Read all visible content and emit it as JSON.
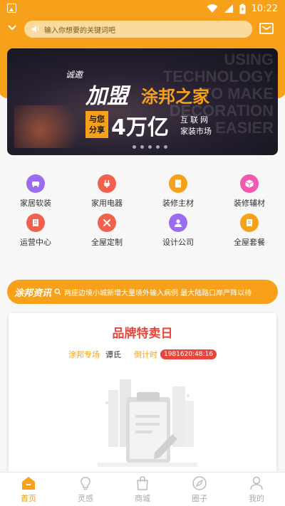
{
  "status_bar": {
    "time": "10:22"
  },
  "header": {
    "search_placeholder": "输入你想要的关键词吧"
  },
  "banner": {
    "tag_small": "诚邀",
    "tag_join": "加盟",
    "brand": "涂邦之家",
    "share_box": "与您分享",
    "amount": "4万亿",
    "right_line1": "互联网",
    "right_line2": "家装市场",
    "bg_text": "USING TECHNOLOGY TO MAKE DECORATION EASIER",
    "dot_count": 5
  },
  "categories": [
    {
      "label": "家居软装",
      "icon": "sofa-icon",
      "color": "#9b6cf0"
    },
    {
      "label": "家用电器",
      "icon": "plug-icon",
      "color": "#f2604e"
    },
    {
      "label": "装修主材",
      "icon": "door-icon",
      "color": "#f7a11a"
    },
    {
      "label": "装修辅材",
      "icon": "box-icon",
      "color": "#f05ab0"
    },
    {
      "label": "运营中心",
      "icon": "building-icon",
      "color": "#f2604e"
    },
    {
      "label": "全屋定制",
      "icon": "tools-icon",
      "color": "#f2604e"
    },
    {
      "label": "设计公司",
      "icon": "designer-icon",
      "color": "#9b6cf0"
    },
    {
      "label": "全屋套餐",
      "icon": "package-icon",
      "color": "#f7a11a"
    }
  ],
  "news": {
    "brand": "涂邦资讯",
    "headline": "两座边境小城新增大量境外输入病例 最大陆路口岸严阵以待"
  },
  "promo": {
    "title": "品牌特卖日",
    "source_label": "涂邦专场",
    "brand_name": "谭氏",
    "countdown_label": "倒计时",
    "countdown_value": "1981620:48:16"
  },
  "tabbar": [
    {
      "label": "首页",
      "icon": "home-icon",
      "active": true
    },
    {
      "label": "灵感",
      "icon": "bulb-icon",
      "active": false
    },
    {
      "label": "商城",
      "icon": "shopping-bag-icon",
      "active": false
    },
    {
      "label": "圈子",
      "icon": "compass-icon",
      "active": false
    },
    {
      "label": "我的",
      "icon": "user-icon",
      "active": false
    }
  ],
  "colors": {
    "accent": "#f7a11a",
    "red": "#e8453c"
  }
}
